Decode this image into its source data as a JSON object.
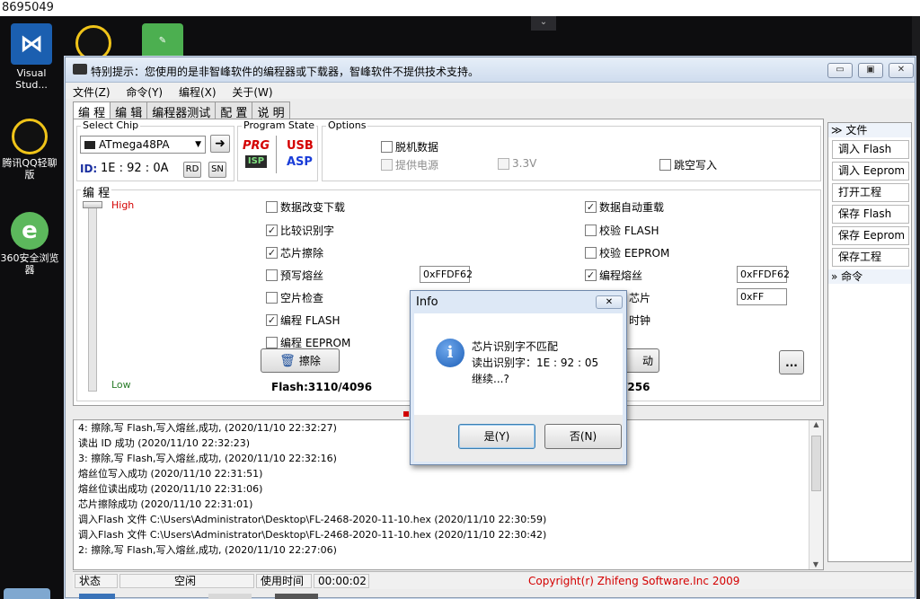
{
  "desktop": {
    "top_text": "8695049",
    "icons": [
      {
        "label": "Visual Stud..."
      },
      {
        "label": "腾讯QQ轻聊版"
      },
      {
        "label": "360安全浏览器"
      }
    ]
  },
  "window": {
    "title": "特别提示：您使用的是非智峰软件的编程器或下载器，智峰软件不提供技术支持。",
    "menu": [
      "文件(Z)",
      "命令(Y)",
      "编程(X)",
      "关于(W)"
    ],
    "tabs": [
      "编 程",
      "编 辑",
      "编程器测试",
      "配 置",
      "说 明"
    ],
    "active_tab": 0
  },
  "select_chip": {
    "label": "Select Chip",
    "chip": "ATmega48PA",
    "id_label": "ID:",
    "id_value": "1E : 92 : 0A",
    "rd": "RD",
    "sn": "SN"
  },
  "program_state": {
    "label": "Program State",
    "prg": "PRG",
    "isp": "ISP",
    "usb": "USB",
    "asp": "ASP"
  },
  "options": {
    "label": "Options",
    "items": [
      {
        "label": "脱机数据",
        "checked": false,
        "disabled": false
      },
      {
        "label": "提供电源",
        "checked": false,
        "disabled": true
      },
      {
        "label": "3.3V",
        "checked": false,
        "disabled": true
      },
      {
        "label": "跳空写入",
        "checked": false,
        "disabled": false
      }
    ]
  },
  "program": {
    "label": "编 程",
    "high": "High",
    "low": "Low",
    "left_checks": [
      {
        "label": "数据改变下载",
        "checked": false
      },
      {
        "label": "比较识别字",
        "checked": true
      },
      {
        "label": "芯片擦除",
        "checked": true
      },
      {
        "label": "预写熔丝",
        "checked": false
      },
      {
        "label": "空片检查",
        "checked": false
      },
      {
        "label": "编程 FLASH",
        "checked": true
      },
      {
        "label": "编程 EEPROM",
        "checked": false
      }
    ],
    "right_checks": [
      {
        "label": "数据自动重载",
        "checked": true
      },
      {
        "label": "校验 FLASH",
        "checked": false
      },
      {
        "label": "校验 EEPROM",
        "checked": false
      },
      {
        "label": "编程熔丝",
        "checked": true
      }
    ],
    "right_partial": [
      "芯片",
      "时钟"
    ],
    "prewrite_fuse_value": "0xFFDF62",
    "program_fuse_value": "0xFFDF62",
    "lock_value": "0xFF",
    "erase_button": "擦除",
    "auto_button_partial": "动",
    "more_button": "...",
    "flash_size": "Flash:3110/4096",
    "eeprom_partial": "/256"
  },
  "sidebar": {
    "file_header": "文件",
    "buttons": [
      "调入 Flash",
      "调入 Eeprom",
      "打开工程",
      "保存 Flash",
      "保存 Eeprom",
      "保存工程"
    ],
    "cmd_header": "命令"
  },
  "log": [
    "4: 擦除,写 Flash,写入熔丝,成功, (2020/11/10 22:32:27)",
    "读出 ID 成功 (2020/11/10 22:32:23)",
    "3: 擦除,写 Flash,写入熔丝,成功, (2020/11/10 22:32:16)",
    "熔丝位写入成功 (2020/11/10 22:31:51)",
    "熔丝位读出成功 (2020/11/10 22:31:06)",
    "芯片擦除成功 (2020/11/10 22:31:01)",
    "调入Flash 文件 C:\\Users\\Administrator\\Desktop\\FL-2468-2020-11-10.hex (2020/11/10 22:30:59)",
    "调入Flash 文件 C:\\Users\\Administrator\\Desktop\\FL-2468-2020-11-10.hex (2020/11/10 22:30:42)",
    "2: 擦除,写 Flash,写入熔丝,成功, (2020/11/10 22:27:06)"
  ],
  "status_bar": {
    "state_label": "状态",
    "state_value": "空闲",
    "time_label": "使用时间",
    "time_value": "00:00:02",
    "copyright": "Copyright(r) Zhifeng Software.Inc 2009"
  },
  "dialog": {
    "title": "Info",
    "line1": "芯片识别字不匹配",
    "line2": "读出识别字：1E : 92 : 05",
    "line3": "继续...?",
    "yes": "是(Y)",
    "no": "否(N)"
  },
  "colors": {
    "accent_red": "#d40000",
    "id_blue": "#1a2fa0",
    "info_blue": "#1d5fb8"
  }
}
